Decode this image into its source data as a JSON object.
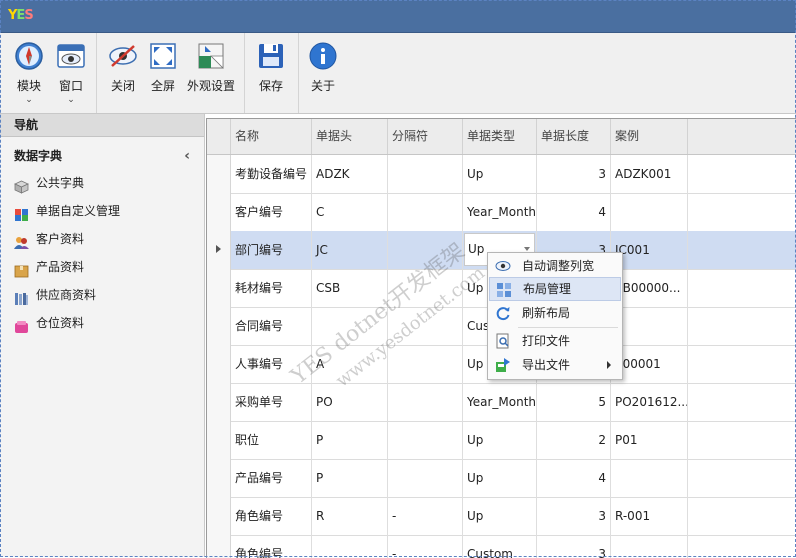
{
  "app": {
    "logo_text": "YES"
  },
  "toolbar": {
    "module_label": "模块",
    "window_label": "窗口",
    "close_label": "关闭",
    "fullscreen_label": "全屏",
    "appearance_label": "外观设置",
    "save_label": "保存",
    "about_label": "关于",
    "dropdown_glyph": "⌄"
  },
  "nav": {
    "header": "导航",
    "group": "数据字典",
    "collapse_glyph": "‹",
    "items": [
      {
        "label": "公共字典",
        "icon": "cube-icon"
      },
      {
        "label": "单据自定义管理",
        "icon": "blocks-icon"
      },
      {
        "label": "客户资料",
        "icon": "people-icon"
      },
      {
        "label": "产品资料",
        "icon": "box-icon"
      },
      {
        "label": "供应商资料",
        "icon": "books-icon"
      },
      {
        "label": "仓位资料",
        "icon": "warehouse-icon"
      }
    ]
  },
  "grid": {
    "columns": [
      "名称",
      "单据头",
      "分隔符",
      "单据类型",
      "单据长度",
      "案例"
    ],
    "rows": [
      {
        "name": "考勤设备编号",
        "head": "ADZK",
        "sep": "",
        "type": "Up",
        "len": "3",
        "example": "ADZK001"
      },
      {
        "name": "客户编号",
        "head": "C",
        "sep": "",
        "type": "Year_Month",
        "len": "4",
        "example": ""
      },
      {
        "name": "部门编号",
        "head": "JC",
        "sep": "",
        "type": "Up",
        "len": "3",
        "example": "JC001"
      },
      {
        "name": "耗材编号",
        "head": "CSB",
        "sep": "",
        "type": "Up",
        "len": "",
        "example": "SB00000..."
      },
      {
        "name": "合同编号",
        "head": "",
        "sep": "",
        "type": "Cust",
        "len": "",
        "example": ""
      },
      {
        "name": "人事编号",
        "head": "A",
        "sep": "",
        "type": "Up",
        "len": "",
        "example": "000001"
      },
      {
        "name": "采购单号",
        "head": "PO",
        "sep": "",
        "type": "Year_Month",
        "len": "5",
        "example": "PO201612..."
      },
      {
        "name": "职位",
        "head": "P",
        "sep": "",
        "type": "Up",
        "len": "2",
        "example": "P01"
      },
      {
        "name": "产品编号",
        "head": "P",
        "sep": "",
        "type": "Up",
        "len": "4",
        "example": ""
      },
      {
        "name": "角色编号",
        "head": "R",
        "sep": "-",
        "type": "Up",
        "len": "3",
        "example": "R-001"
      },
      {
        "name": "角色编号",
        "head": "",
        "sep": "-",
        "type": "Custom",
        "len": "3",
        "example": ""
      }
    ],
    "selected_row": 2
  },
  "context_menu": {
    "items": [
      {
        "label": "自动调整列宽",
        "icon": "eye-icon"
      },
      {
        "label": "布局管理",
        "icon": "layout-icon"
      },
      {
        "label": "刷新布局",
        "icon": "refresh-icon"
      },
      {
        "label": "打印文件",
        "icon": "print-preview-icon"
      },
      {
        "label": "导出文件",
        "icon": "export-icon"
      }
    ]
  },
  "watermark": {
    "line1": "YES dotnet开发框架",
    "line2": "www.yesdotnet.com"
  },
  "colors": {
    "titlebar": "#4a6fa0",
    "selection": "#cfdcf2",
    "menu_highlight": "#dde6f5"
  }
}
